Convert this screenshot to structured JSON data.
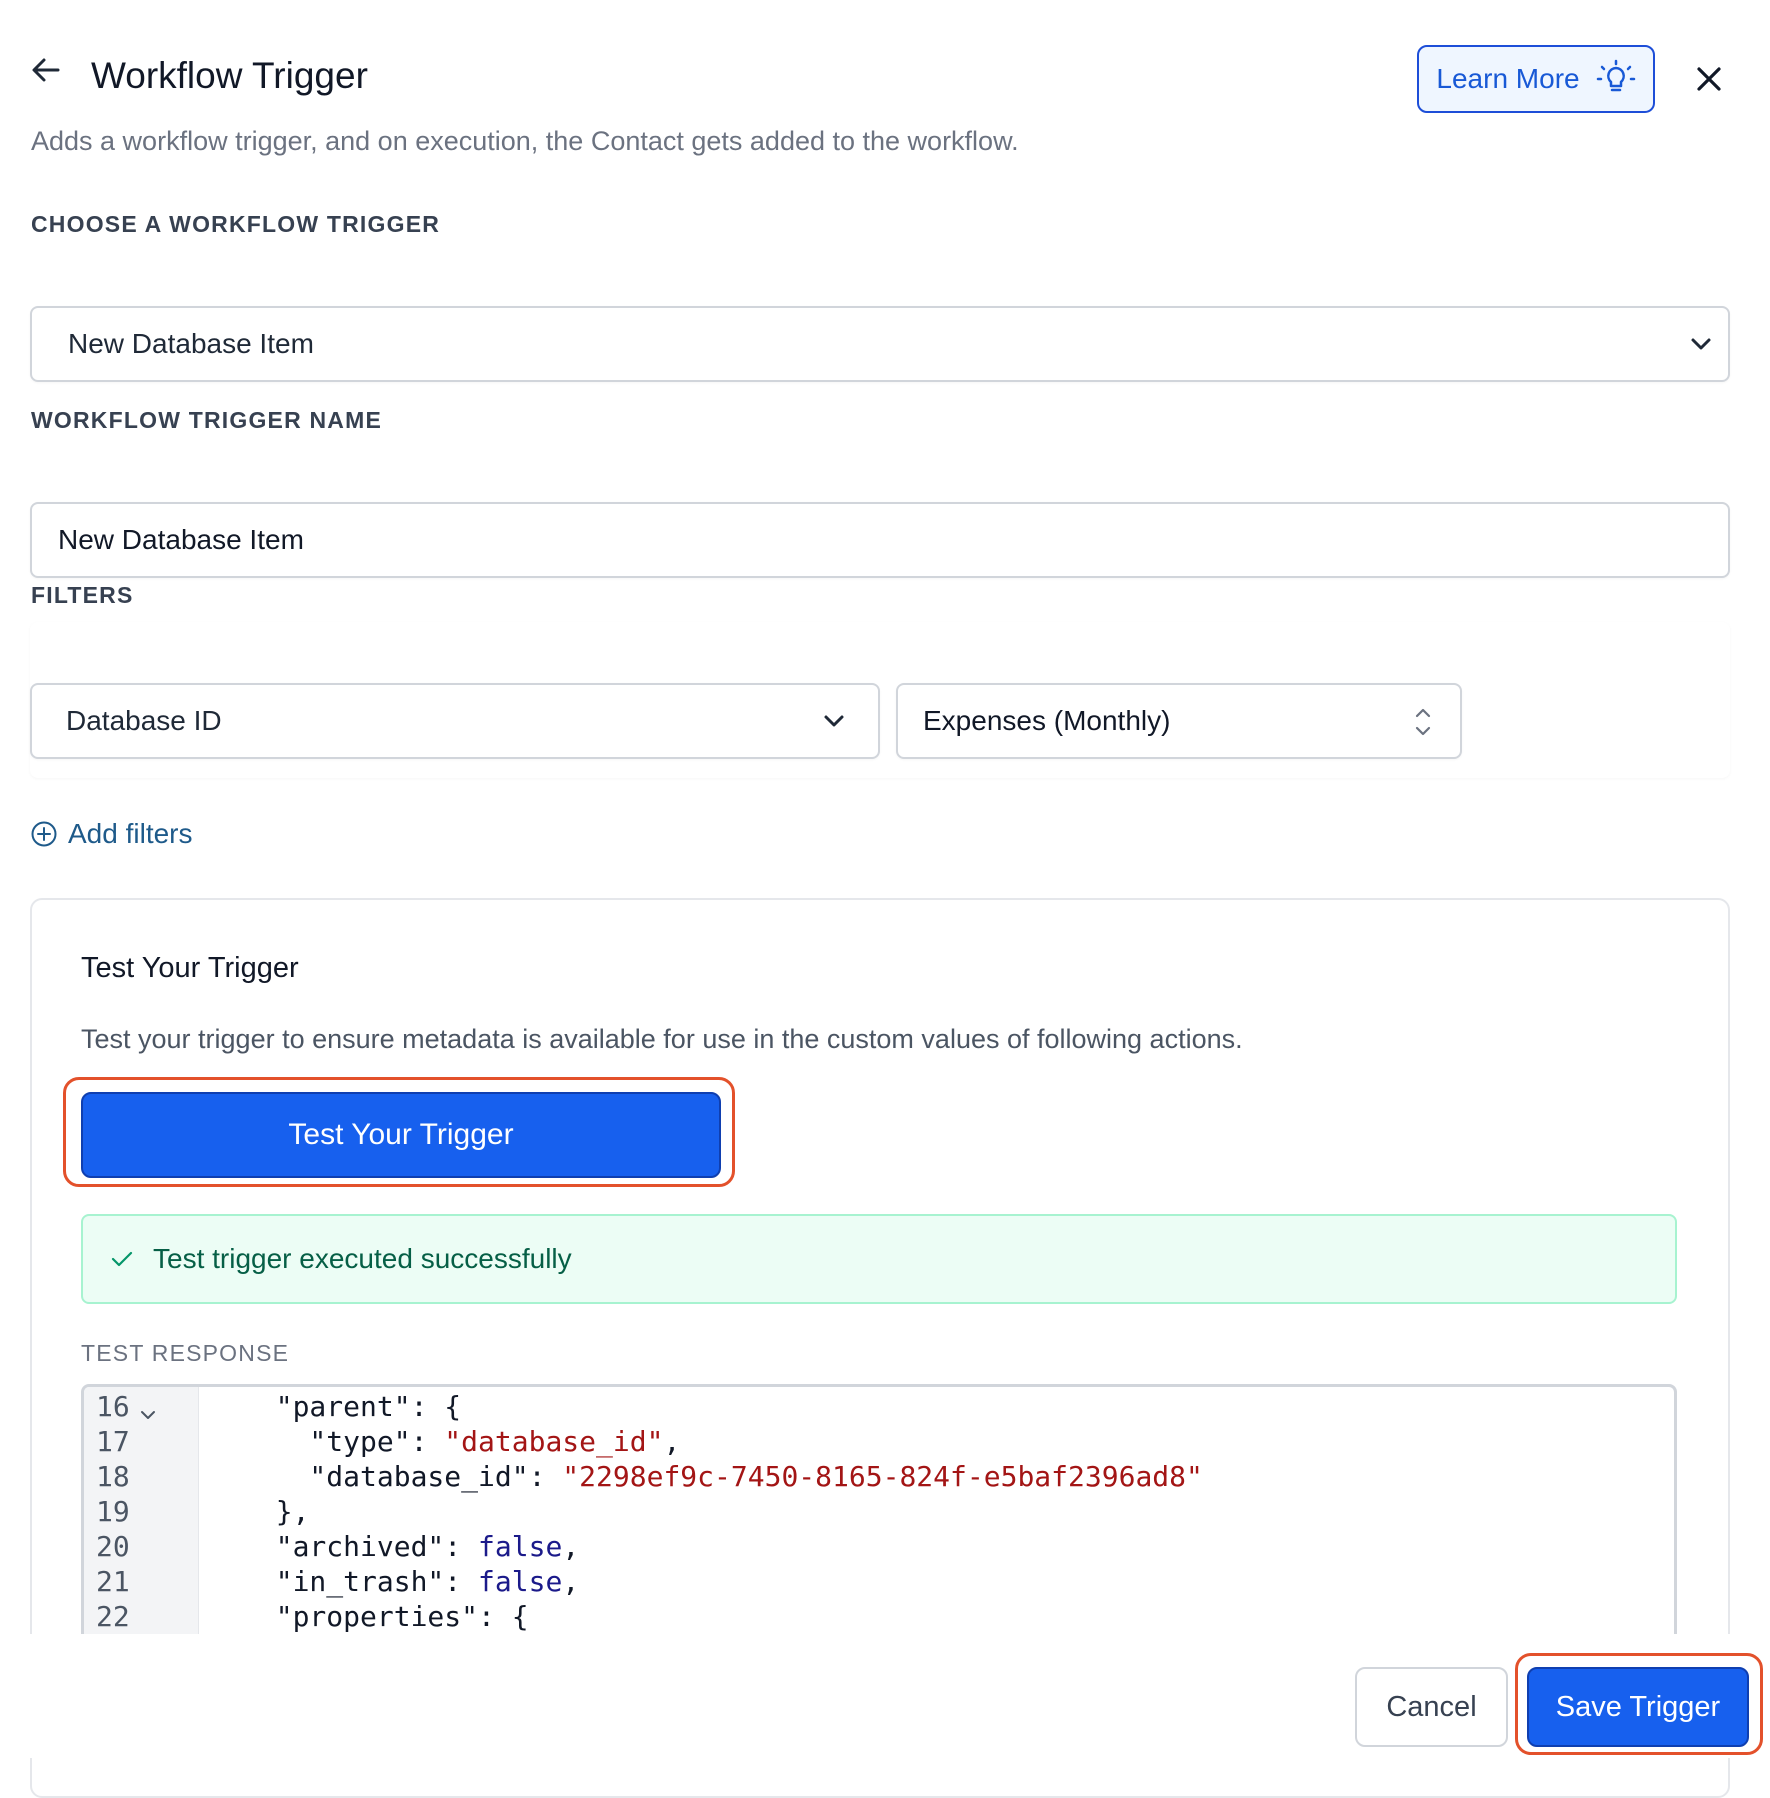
{
  "header": {
    "title": "Workflow Trigger",
    "subtitle": "Adds a workflow trigger, and on execution, the Contact gets added to the workflow.",
    "learn_more_label": "Learn More"
  },
  "trigger_section": {
    "label": "CHOOSE A WORKFLOW TRIGGER",
    "selected_value": "New Database Item"
  },
  "name_section": {
    "label": "WORKFLOW TRIGGER NAME",
    "value": "New Database Item"
  },
  "filters": {
    "label": "FILTERS",
    "key_value": "Database ID",
    "value_value": "Expenses (Monthly)",
    "add_label": "Add filters"
  },
  "test": {
    "title": "Test Your Trigger",
    "description": "Test your trigger to ensure metadata is available for use in the custom values of following actions.",
    "button_label": "Test Your Trigger",
    "success_message": "Test trigger executed successfully",
    "response_label": "TEST RESPONSE",
    "code_lines": [
      {
        "n": "16",
        "key": "  \"parent\"",
        "rest": ": {"
      },
      {
        "n": "17",
        "key": "    \"type\"",
        "str": "\"database_id\"",
        "end": ","
      },
      {
        "n": "18",
        "key": "    \"database_id\"",
        "str": "\"2298ef9c-7450-8165-824f-e5baf2396ad8\"",
        "end": ""
      },
      {
        "n": "19",
        "key": "  },",
        "rest": ""
      },
      {
        "n": "20",
        "key": "  \"archived\"",
        "kw": "false",
        "end": ","
      },
      {
        "n": "21",
        "key": "  \"in_trash\"",
        "kw": "false",
        "end": ","
      },
      {
        "n": "22",
        "key": "  \"properties\"",
        "rest": ": {"
      }
    ]
  },
  "footer": {
    "cancel_label": "Cancel",
    "save_label": "Save Trigger"
  },
  "colors": {
    "primary": "#1760ee",
    "highlight": "#e3512b",
    "success_bg": "#ecfdf5"
  }
}
